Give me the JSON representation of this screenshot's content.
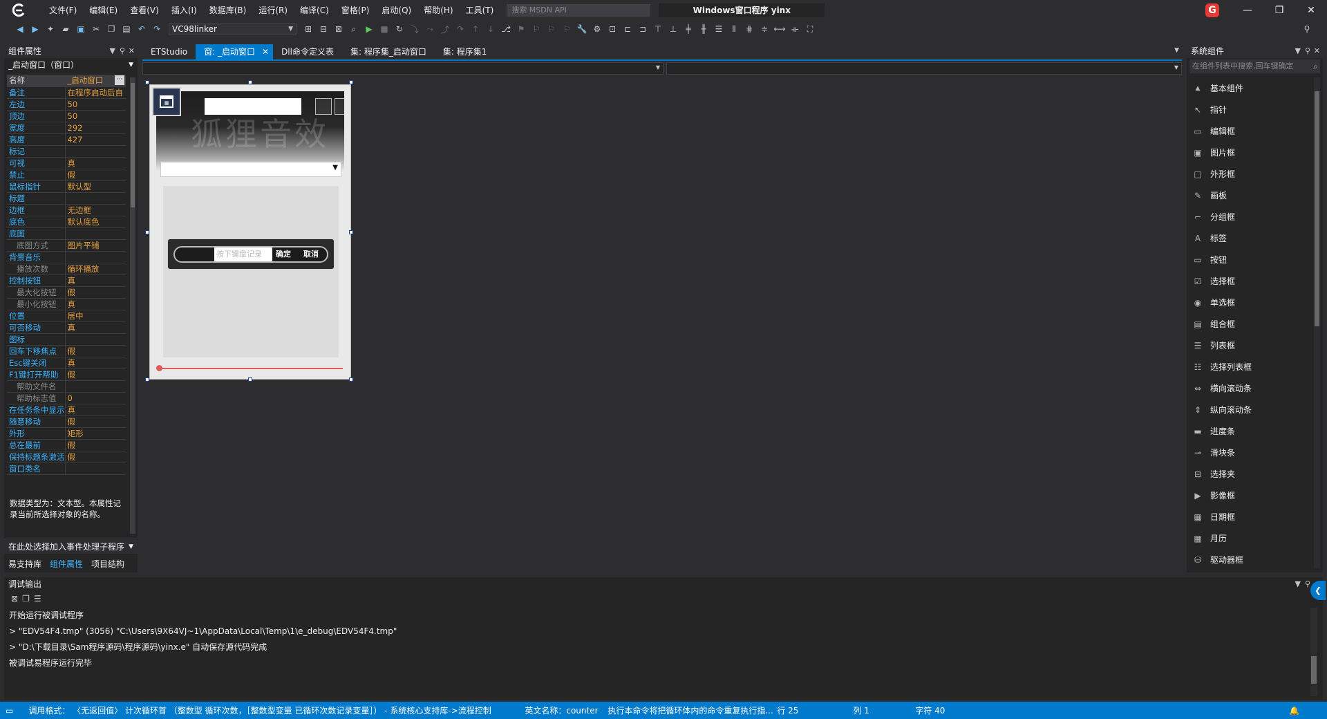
{
  "menu": [
    "文件(F)",
    "编辑(E)",
    "查看(V)",
    "插入(I)",
    "数据库(B)",
    "运行(R)",
    "编译(C)",
    "窗格(P)",
    "启动(Q)",
    "帮助(H)",
    "工具(T)"
  ],
  "search": {
    "placeholder": "搜索 MSDN API"
  },
  "window_title": "Windows窗口程序  yinx",
  "toolbar": {
    "config": "VC98linker"
  },
  "left_panel": {
    "title": "组件属性",
    "object": "_启动窗口（窗口）",
    "properties": [
      {
        "k": "名称",
        "v": "_启动窗口"
      },
      {
        "k": "备注",
        "v": "在程序启动后自"
      },
      {
        "k": "左边",
        "v": "50"
      },
      {
        "k": "顶边",
        "v": "50"
      },
      {
        "k": "宽度",
        "v": "292"
      },
      {
        "k": "高度",
        "v": "427"
      },
      {
        "k": "标记",
        "v": ""
      },
      {
        "k": "可视",
        "v": "真"
      },
      {
        "k": "禁止",
        "v": "假"
      },
      {
        "k": "鼠标指针",
        "v": "默认型"
      },
      {
        "k": "标题",
        "v": ""
      },
      {
        "k": "边框",
        "v": "无边框"
      },
      {
        "k": "底色",
        "v": "默认底色"
      },
      {
        "k": "底图",
        "v": ""
      },
      {
        "k": "底图方式",
        "v": "图片平铺",
        "sub": true
      },
      {
        "k": "背景音乐",
        "v": ""
      },
      {
        "k": "播放次数",
        "v": "循环播放",
        "sub": true
      },
      {
        "k": "控制按钮",
        "v": "真"
      },
      {
        "k": "最大化按钮",
        "v": "假",
        "sub": true
      },
      {
        "k": "最小化按钮",
        "v": "真",
        "sub": true
      },
      {
        "k": "位置",
        "v": "居中"
      },
      {
        "k": "可否移动",
        "v": "真"
      },
      {
        "k": "图标",
        "v": ""
      },
      {
        "k": "回车下移焦点",
        "v": "假"
      },
      {
        "k": "Esc键关闭",
        "v": "真"
      },
      {
        "k": "F1键打开帮助",
        "v": "假"
      },
      {
        "k": "帮助文件名",
        "v": "",
        "sub": true
      },
      {
        "k": "帮助标志值",
        "v": "0",
        "sub": true
      },
      {
        "k": "在任务条中显示",
        "v": "真"
      },
      {
        "k": "随意移动",
        "v": "假"
      },
      {
        "k": "外形",
        "v": "矩形"
      },
      {
        "k": "总在最前",
        "v": "假"
      },
      {
        "k": "保持标题条激活",
        "v": "假"
      },
      {
        "k": "窗口类名",
        "v": ""
      }
    ],
    "description": "数据类型为：文本型。本属性记录当前所选择对象的名称。",
    "event_select": "在此处选择加入事件处理子程序",
    "tabs": [
      "易支持库",
      "组件属性",
      "项目结构"
    ]
  },
  "doc_tabs": [
    {
      "label": "ETStudio",
      "active": false
    },
    {
      "label": "窗: _启动窗口",
      "active": true
    },
    {
      "label": "Dll命令定义表",
      "active": false
    },
    {
      "label": "集: 程序集_启动窗口",
      "active": false
    },
    {
      "label": "集: 程序集1",
      "active": false
    }
  ],
  "form": {
    "watermark": "狐狸音效",
    "input_placeholder": "按下键盘记录",
    "ok": "确定",
    "cancel": "取消"
  },
  "right_panel": {
    "title": "系统组件",
    "search_placeholder": "在组件列表中搜索,回车键确定",
    "items": [
      {
        "label": "基本组件",
        "icon": "▲",
        "group": true
      },
      {
        "label": "指针",
        "icon": "↖"
      },
      {
        "label": "编辑框",
        "icon": "▭"
      },
      {
        "label": "图片框",
        "icon": "▣"
      },
      {
        "label": "外形框",
        "icon": "□"
      },
      {
        "label": "画板",
        "icon": "✎"
      },
      {
        "label": "分组框",
        "icon": "⌐"
      },
      {
        "label": "标签",
        "icon": "A"
      },
      {
        "label": "按钮",
        "icon": "▭"
      },
      {
        "label": "选择框",
        "icon": "☑"
      },
      {
        "label": "单选框",
        "icon": "◉"
      },
      {
        "label": "组合框",
        "icon": "▤"
      },
      {
        "label": "列表框",
        "icon": "☰"
      },
      {
        "label": "选择列表框",
        "icon": "☷"
      },
      {
        "label": "横向滚动条",
        "icon": "⇔"
      },
      {
        "label": "纵向滚动条",
        "icon": "⇕"
      },
      {
        "label": "进度条",
        "icon": "▬"
      },
      {
        "label": "滑块条",
        "icon": "⊸"
      },
      {
        "label": "选择夹",
        "icon": "⊟"
      },
      {
        "label": "影像框",
        "icon": "▶"
      },
      {
        "label": "日期框",
        "icon": "▦"
      },
      {
        "label": "月历",
        "icon": "▦"
      },
      {
        "label": "驱动器框",
        "icon": "⛁"
      }
    ]
  },
  "debug": {
    "title": "调试输出",
    "lines": [
      "开始运行被调试程序",
      "> \"EDV54F4.tmp\" (3056) \"C:\\Users\\9X64VJ~1\\AppData\\Local\\Temp\\1\\e_debug\\EDV54F4.tmp\"",
      "> \"D:\\下载目录\\Sam程序源码\\程序源码\\yinx.e\" 自动保存源代码完成",
      "被调试易程序运行完毕"
    ]
  },
  "status": {
    "call": "调用格式：  〈无返回值〉 计次循环首 （整数型 循环次数，［整数型变量 已循环次数记录变量］） - 系统核心支持库->流程控制",
    "eng": "英文名称：counter",
    "desc": "执行本命令将把循环体内的命令重复执行指...",
    "row": "行 25",
    "col": "列 1",
    "chars": "字符 40"
  },
  "colors": {
    "accent": "#007acc",
    "property_key": "#3ab4ff",
    "property_value": "#e7a13f",
    "brand": "#e53935"
  }
}
